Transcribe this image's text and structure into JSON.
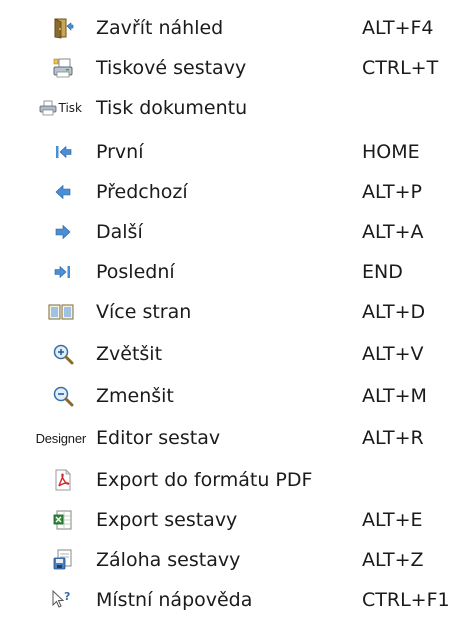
{
  "menu": {
    "items": [
      {
        "label": "Zavřít náhled",
        "shortcut": "ALT+F4",
        "icon": "close-preview-icon"
      },
      {
        "label": "Tiskové sestavy",
        "shortcut": "CTRL+T",
        "icon": "print-reports-icon"
      },
      {
        "label": "Tisk dokumentu",
        "shortcut": "",
        "icon": "print-button-icon",
        "button_text": "Tisk"
      },
      {
        "label": "První",
        "shortcut": "HOME",
        "icon": "first-page-icon"
      },
      {
        "label": "Předchozí",
        "shortcut": "ALT+P",
        "icon": "previous-page-icon"
      },
      {
        "label": "Další",
        "shortcut": "ALT+A",
        "icon": "next-page-icon"
      },
      {
        "label": "Poslední",
        "shortcut": "END",
        "icon": "last-page-icon"
      },
      {
        "label": "Více stran",
        "shortcut": "ALT+D",
        "icon": "multiple-pages-icon"
      },
      {
        "label": "Zvětšit",
        "shortcut": "ALT+V",
        "icon": "zoom-in-icon"
      },
      {
        "label": "Zmenšit",
        "shortcut": "ALT+M",
        "icon": "zoom-out-icon"
      },
      {
        "label": "Editor sestav",
        "shortcut": "ALT+R",
        "icon": "designer-icon",
        "button_text": "Designer"
      },
      {
        "label": "Export do formátu PDF",
        "shortcut": "",
        "icon": "pdf-export-icon"
      },
      {
        "label": "Export sestavy",
        "shortcut": "ALT+E",
        "icon": "excel-export-icon"
      },
      {
        "label": "Záloha sestavy",
        "shortcut": "ALT+Z",
        "icon": "backup-report-icon"
      },
      {
        "label": "Místní nápověda",
        "shortcut": "CTRL+F1",
        "icon": "context-help-icon"
      }
    ]
  },
  "colors": {
    "arrow_blue": "#4a8fd6",
    "pdf_red": "#d2262b",
    "excel_green": "#2e8b3a"
  }
}
